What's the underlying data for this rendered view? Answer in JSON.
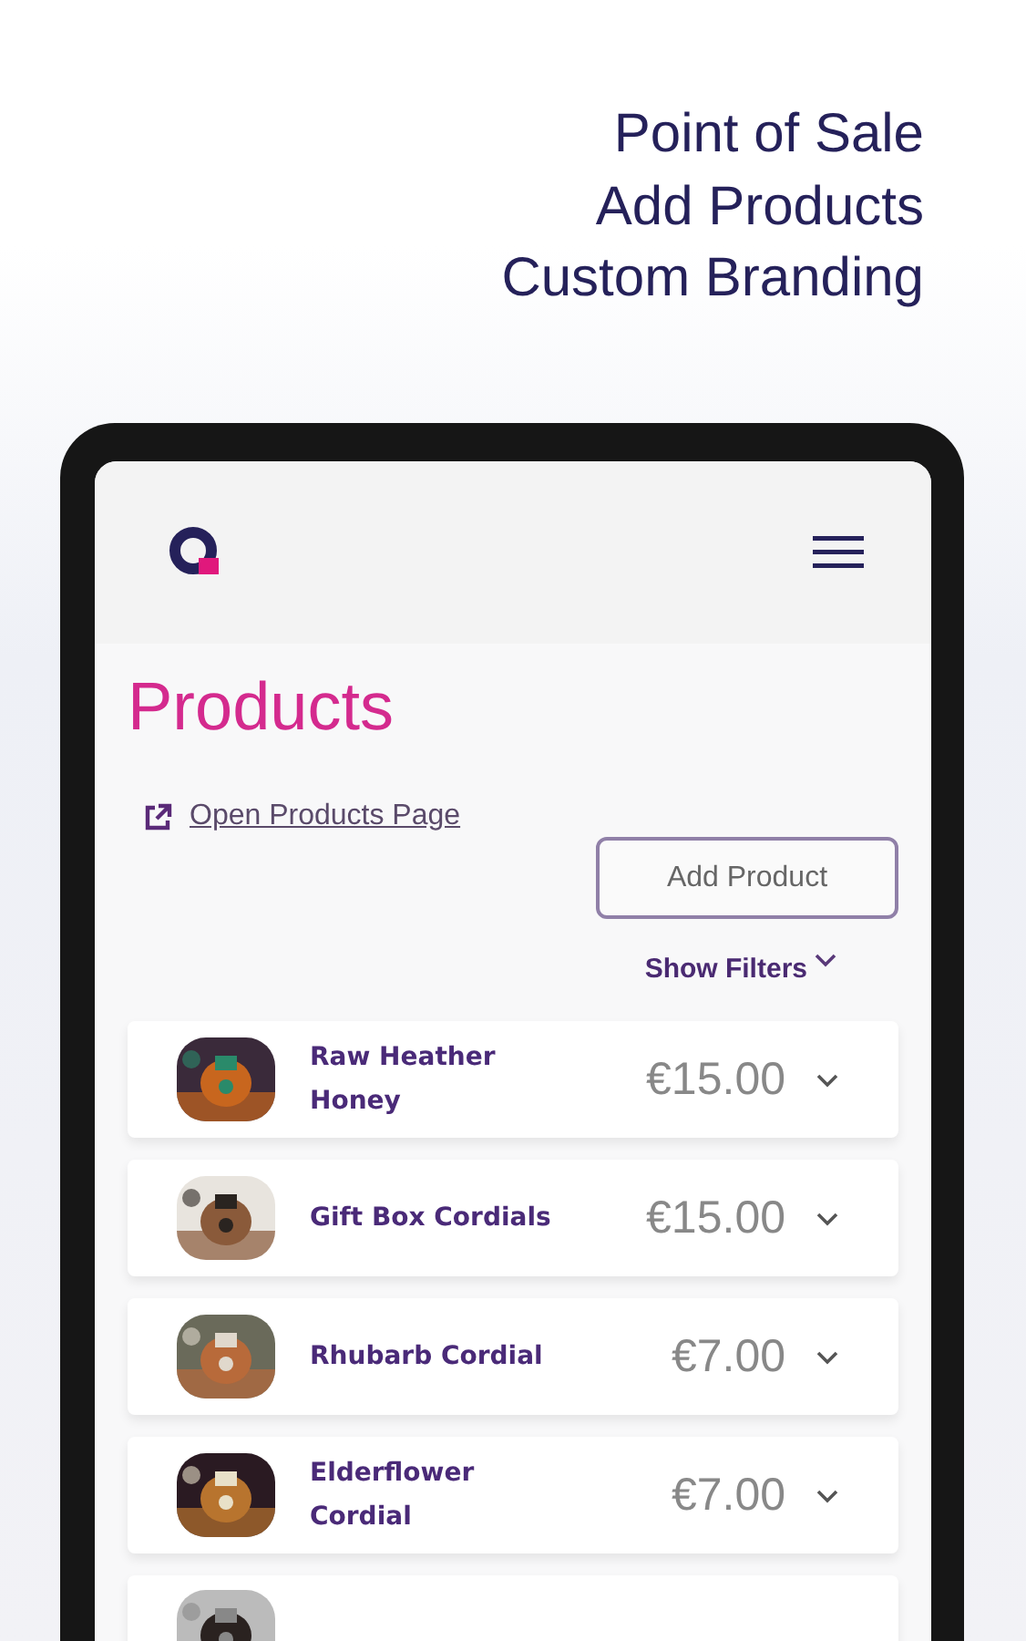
{
  "headline": [
    "Point of Sale",
    "Add Products",
    "Custom Branding"
  ],
  "page_title": "Products",
  "open_link": "Open Products Page",
  "add_button": "Add Product",
  "filters_toggle": "Show Filters",
  "products": [
    {
      "kind": "full",
      "name": "Raw Heather Honey",
      "price": "€15.00"
    },
    {
      "kind": "full",
      "name": "Gift Box Cordials",
      "price": "€15.00"
    },
    {
      "kind": "full",
      "name": "Rhubarb Cordial",
      "price": "€7.00"
    },
    {
      "kind": "full",
      "name": "Elderflower Cordial",
      "price": "€7.00"
    },
    {
      "kind": "cut"
    }
  ]
}
